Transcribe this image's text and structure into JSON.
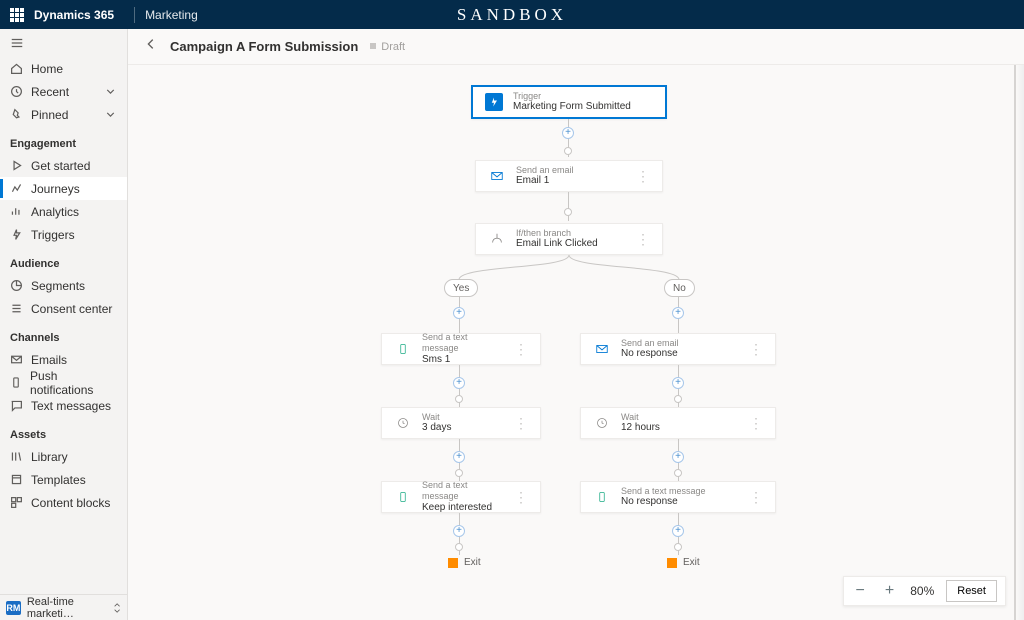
{
  "top": {
    "brand": "Dynamics 365",
    "area": "Marketing",
    "sandbox": "SANDBOX"
  },
  "sidebar": {
    "home": "Home",
    "recent": "Recent",
    "pinned": "Pinned",
    "sections": {
      "engagement": "Engagement",
      "audience": "Audience",
      "channels": "Channels",
      "assets": "Assets"
    },
    "items": {
      "get_started": "Get started",
      "journeys": "Journeys",
      "analytics": "Analytics",
      "triggers": "Triggers",
      "segments": "Segments",
      "consent": "Consent center",
      "emails": "Emails",
      "push": "Push notifications",
      "texts": "Text messages",
      "library": "Library",
      "templates": "Templates",
      "cblocks": "Content blocks"
    },
    "area_switch": {
      "badge": "RM",
      "label": "Real-time marketi…"
    }
  },
  "header": {
    "title": "Campaign A Form Submission",
    "status": "Draft"
  },
  "flow": {
    "trigger": {
      "kind": "Trigger",
      "value": "Marketing Form Submitted"
    },
    "email1": {
      "kind": "Send an email",
      "value": "Email 1"
    },
    "branch": {
      "kind": "If/then branch",
      "value": "Email Link Clicked"
    },
    "yes": "Yes",
    "no": "No",
    "sms1": {
      "kind": "Send a text message",
      "value": "Sms 1"
    },
    "wait_l": {
      "kind": "Wait",
      "value": "3 days"
    },
    "sms2": {
      "kind": "Send a text message",
      "value": "Keep interested"
    },
    "email2": {
      "kind": "Send an email",
      "value": "No response"
    },
    "wait_r": {
      "kind": "Wait",
      "value": "12 hours"
    },
    "sms3": {
      "kind": "Send a text message",
      "value": "No response"
    },
    "exit": "Exit"
  },
  "zoom": {
    "level": "80%",
    "reset": "Reset"
  }
}
